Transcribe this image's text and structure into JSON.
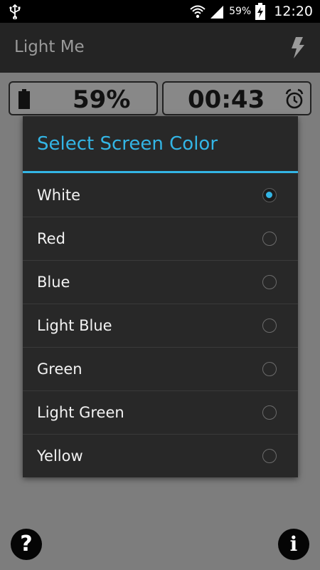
{
  "status_bar": {
    "battery_percent": "59%",
    "time": "12:20",
    "icons": [
      "usb-icon",
      "wifi-icon",
      "signal-icon",
      "battery-charging-icon"
    ]
  },
  "app_bar": {
    "title": "Light Me",
    "flash_icon": "flash-icon"
  },
  "panels": {
    "battery_value": "59%",
    "timer_value": "00:43",
    "battery_icon": "battery-icon",
    "alarm_icon": "alarm-clock-icon"
  },
  "dialog": {
    "title": "Select Screen Color",
    "accent_color": "#33b5e5",
    "options": [
      {
        "label": "White",
        "selected": true
      },
      {
        "label": "Red",
        "selected": false
      },
      {
        "label": "Blue",
        "selected": false
      },
      {
        "label": "Light Blue",
        "selected": false
      },
      {
        "label": "Green",
        "selected": false
      },
      {
        "label": "Light Green",
        "selected": false
      },
      {
        "label": "Yellow",
        "selected": false
      }
    ]
  },
  "bottom": {
    "help_glyph": "?",
    "info_glyph": "i"
  }
}
